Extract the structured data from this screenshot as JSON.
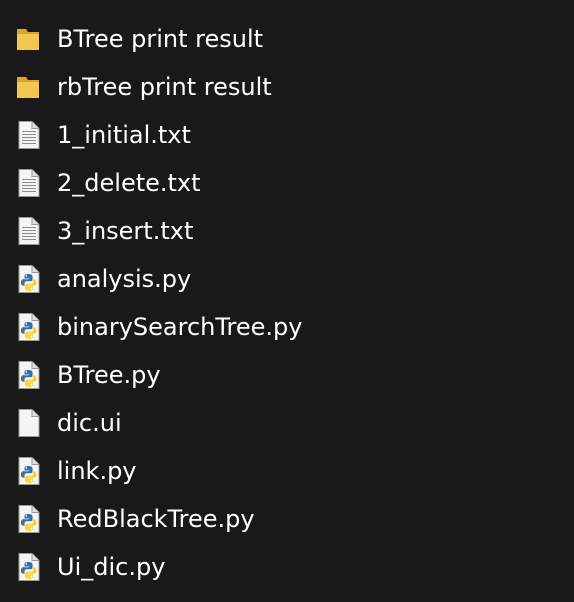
{
  "files": [
    {
      "name": "BTree print result",
      "icon": "folder-icon"
    },
    {
      "name": "rbTree print result",
      "icon": "folder-icon"
    },
    {
      "name": "1_initial.txt",
      "icon": "text-file-icon"
    },
    {
      "name": "2_delete.txt",
      "icon": "text-file-icon"
    },
    {
      "name": "3_insert.txt",
      "icon": "text-file-icon"
    },
    {
      "name": "analysis.py",
      "icon": "python-file-icon"
    },
    {
      "name": "binarySearchTree.py",
      "icon": "python-file-icon"
    },
    {
      "name": "BTree.py",
      "icon": "python-file-icon"
    },
    {
      "name": "dic.ui",
      "icon": "blank-file-icon"
    },
    {
      "name": "link.py",
      "icon": "python-file-icon"
    },
    {
      "name": "RedBlackTree.py",
      "icon": "python-file-icon"
    },
    {
      "name": "Ui_dic.py",
      "icon": "python-file-icon"
    }
  ],
  "colors": {
    "background": "#191919",
    "folder": "#f3c74d",
    "folder_dark": "#d9a730",
    "python_blue": "#3572a5",
    "python_yellow": "#ffd43b",
    "page": "#f4f4f4"
  }
}
